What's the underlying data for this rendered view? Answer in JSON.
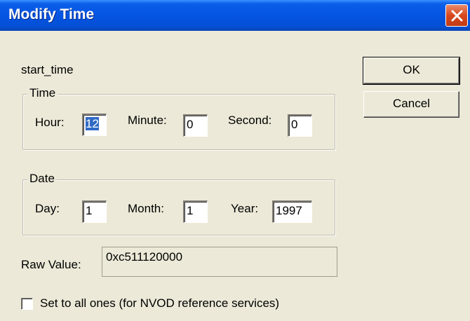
{
  "window": {
    "title": "Modify Time"
  },
  "field_name": "start_time",
  "buttons": {
    "ok": "OK",
    "cancel": "Cancel"
  },
  "time_group": {
    "legend": "Time",
    "hour_label": "Hour:",
    "hour_value": "12",
    "minute_label": "Minute:",
    "minute_value": "0",
    "second_label": "Second:",
    "second_value": "0"
  },
  "date_group": {
    "legend": "Date",
    "day_label": "Day:",
    "day_value": "1",
    "month_label": "Month:",
    "month_value": "1",
    "year_label": "Year:",
    "year_value": "1997"
  },
  "raw_value": {
    "label": "Raw Value:",
    "value": "0xc511120000"
  },
  "all_ones": {
    "label": "Set to all ones (for NVOD reference services)",
    "checked": false
  },
  "colors": {
    "titlebar": "#0554e3",
    "dialog_bg": "#ece9d8",
    "selection": "#316ac5",
    "close": "#d7481e"
  }
}
